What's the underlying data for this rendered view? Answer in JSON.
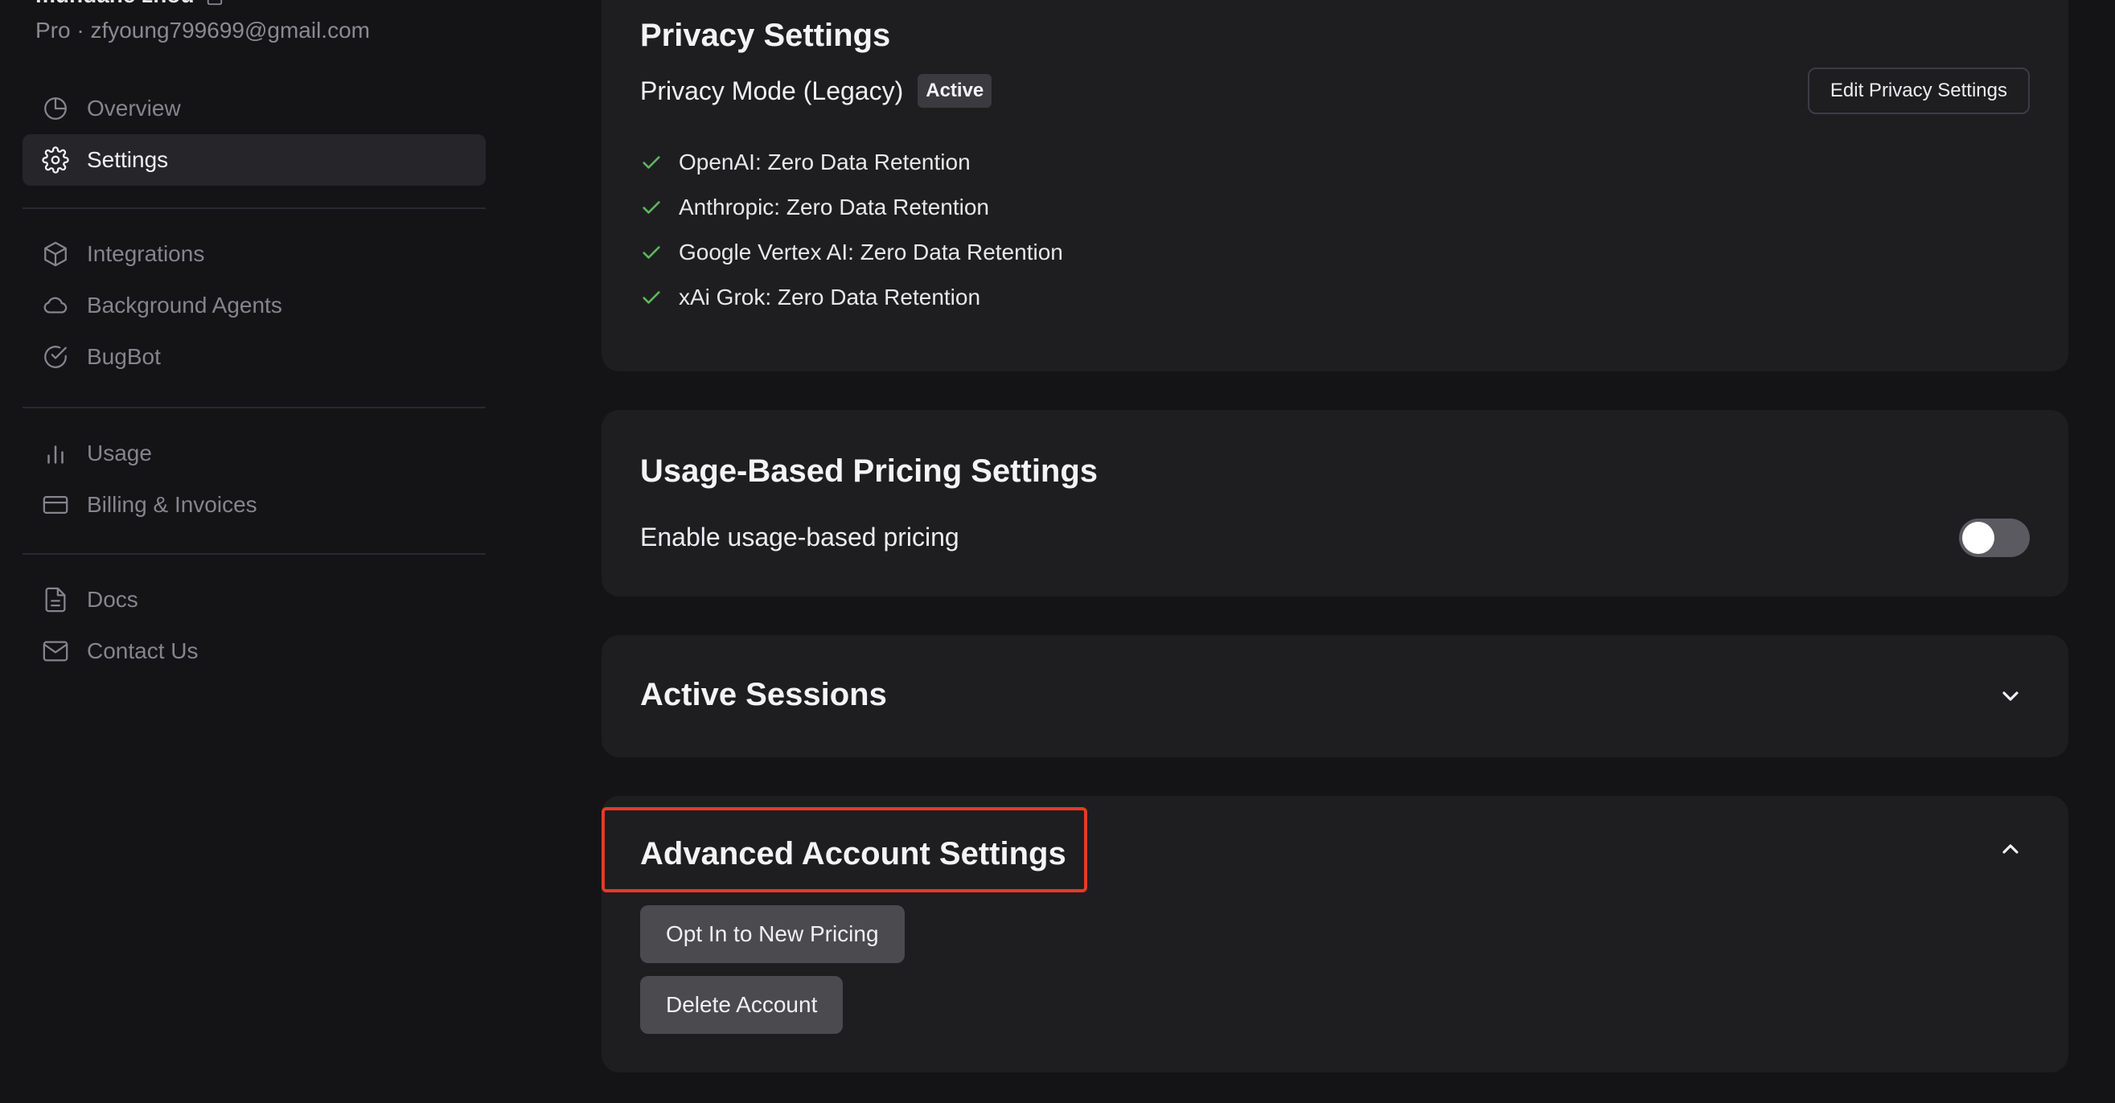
{
  "user": {
    "name": "mundane zhou",
    "plan_email": "Pro · zfyoung799699@gmail.com"
  },
  "sidebar": {
    "groups": [
      [
        {
          "label": "Overview",
          "icon": "pie-chart-icon"
        },
        {
          "label": "Settings",
          "icon": "gear-icon",
          "selected": true
        }
      ],
      [
        {
          "label": "Integrations",
          "icon": "cube-icon"
        },
        {
          "label": "Background Agents",
          "icon": "cloud-icon"
        },
        {
          "label": "BugBot",
          "icon": "check-circle-icon"
        }
      ],
      [
        {
          "label": "Usage",
          "icon": "bar-chart-icon"
        },
        {
          "label": "Billing & Invoices",
          "icon": "credit-card-icon"
        }
      ],
      [
        {
          "label": "Docs",
          "icon": "document-icon"
        },
        {
          "label": "Contact Us",
          "icon": "mail-icon"
        }
      ]
    ]
  },
  "privacy": {
    "title": "Privacy Settings",
    "mode_label": "Privacy Mode (Legacy)",
    "badge": "Active",
    "edit_button": "Edit Privacy Settings",
    "items": [
      "OpenAI: Zero Data Retention",
      "Anthropic: Zero Data Retention",
      "Google Vertex AI: Zero Data Retention",
      "xAi Grok: Zero Data Retention"
    ]
  },
  "usage_pricing": {
    "title": "Usage-Based Pricing Settings",
    "toggle_label": "Enable usage-based pricing",
    "enabled": false
  },
  "sessions": {
    "title": "Active Sessions"
  },
  "advanced": {
    "title": "Advanced Account Settings",
    "opt_in_button": "Opt In to New Pricing",
    "delete_button": "Delete Account"
  },
  "colors": {
    "page_bg": "#141416",
    "card_bg": "#1e1e21",
    "check_green": "#5cb85c",
    "highlight_red": "#e5392b"
  }
}
